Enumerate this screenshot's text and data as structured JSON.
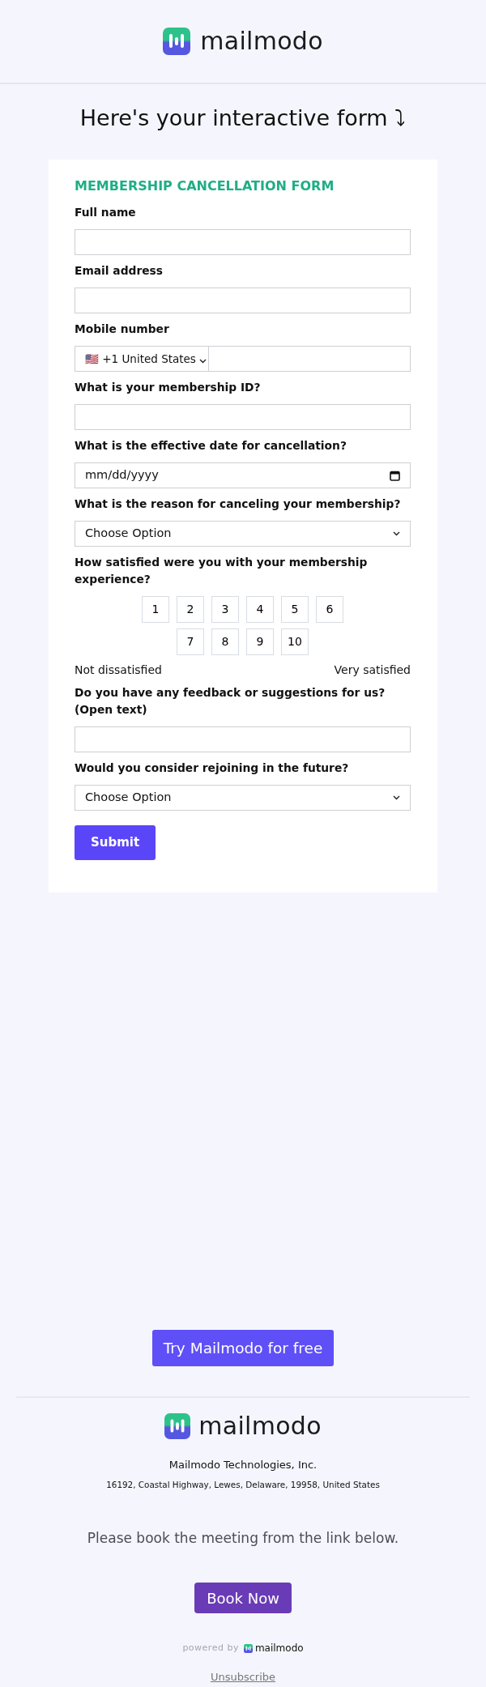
{
  "header": {
    "logo_text": "mailmodo"
  },
  "title": "Here's your interactive form ⤵",
  "form": {
    "heading": "MEMBERSHIP CANCELLATION FORM",
    "fields": [
      {
        "kind": "text",
        "label": "Full name"
      },
      {
        "kind": "text",
        "label": "Email address"
      },
      {
        "kind": "phone",
        "label": "Mobile number",
        "country": "🇺🇸 +1 United States"
      },
      {
        "kind": "text",
        "label": "What is your membership ID?"
      },
      {
        "kind": "date",
        "label": "What is the effective date for cancellation?",
        "placeholder": "mm/dd/yyyy"
      },
      {
        "kind": "select",
        "label": "What is the reason for canceling your membership?",
        "value": "Choose Option"
      },
      {
        "kind": "scale",
        "label": "How satisfied were you with your membership experience?",
        "options": [
          "1",
          "2",
          "3",
          "4",
          "5",
          "6",
          "7",
          "8",
          "9",
          "10"
        ],
        "low_label": "Not dissatisfied",
        "high_label": "Very satisfied"
      },
      {
        "kind": "text",
        "label": "Do you have any feedback or suggestions for us? (Open text)"
      },
      {
        "kind": "select",
        "label": "Would you consider rejoining in the future?",
        "value": "Choose Option"
      }
    ],
    "submit": "Submit"
  },
  "footer": {
    "cta": "Try Mailmodo for free",
    "logo_text": "mailmodo",
    "company": "Mailmodo Technologies, Inc.",
    "address": "16192, Coastal Highway, Lewes, Delaware, 19958, United States",
    "message": "Please book the meeting from the link below.",
    "book_button": "Book Now",
    "powered_by": "powered by",
    "powered_logo_text": "mailmodo",
    "unsubscribe": "Unsubscribe"
  }
}
